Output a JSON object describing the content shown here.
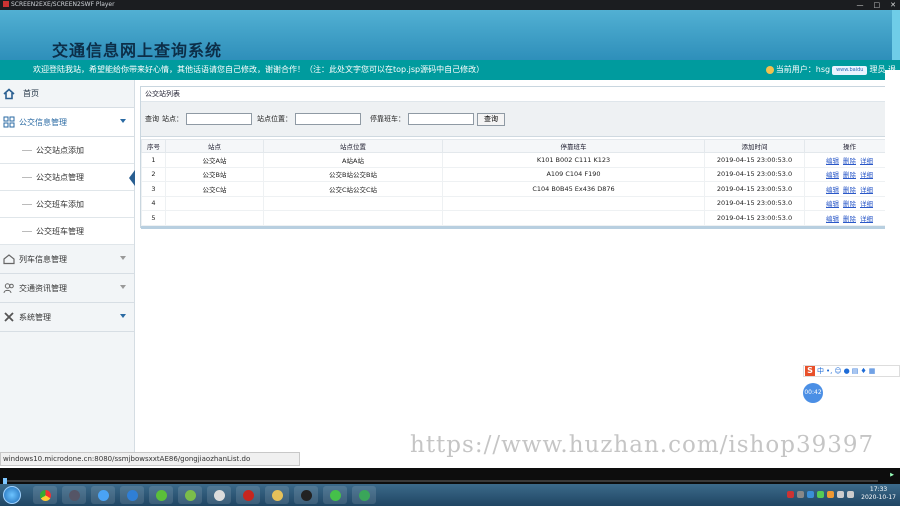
{
  "window": {
    "title": "SCREEN2EXE/SCREEN2SWF Player"
  },
  "header": {
    "system_title": "交通信息网上查询系统"
  },
  "notice": {
    "message": "欢迎登陆我站，希望能给你带来好心情，其他话语请您自己修改，谢谢合作！（注：此处文字您可以在top.jsp源码中自己修改）",
    "user_label": "当前用户：hsg",
    "cloud_badge": "www.baidu",
    "trailing": "理员 退"
  },
  "sidebar": {
    "home": "首页",
    "groups": [
      {
        "label": "公交信息管理",
        "expanded": true,
        "subitems": [
          "公交站点添加",
          "公交站点管理",
          "公交班车添加",
          "公交班车管理"
        ],
        "current": "公交站点管理"
      },
      {
        "label": "列车信息管理",
        "expanded": false
      },
      {
        "label": "交通资讯管理",
        "expanded": false
      },
      {
        "label": "系统管理",
        "expanded": false
      }
    ]
  },
  "panel": {
    "title": "公交站列表",
    "search": {
      "prefix": "查询",
      "station_label": "站点：",
      "location_label": "站点位置：",
      "bus_label": "停靠班车：",
      "station_value": "",
      "location_value": "",
      "bus_value": "",
      "button": "查询"
    },
    "table": {
      "headers": [
        "序号",
        "站点",
        "站点位置",
        "停靠班车",
        "添加时间",
        "操作"
      ],
      "rows": [
        {
          "no": "1",
          "station": "公交A站",
          "location": "A站A站",
          "buses": "K101 B002 C111 K123",
          "time": "2019-04-15 23:00:53.0"
        },
        {
          "no": "2",
          "station": "公交B站",
          "location": "公交B站公交B站",
          "buses": "A109 C104 F190",
          "time": "2019-04-15 23:00:53.0"
        },
        {
          "no": "3",
          "station": "公交C站",
          "location": "公交C站公交C站",
          "buses": "C104 B0B45 Ex436 D876",
          "time": "2019-04-15 23:00:53.0"
        },
        {
          "no": "4",
          "station": "",
          "location": "",
          "buses": "",
          "time": "2019-04-15 23:00:53.0"
        },
        {
          "no": "5",
          "station": "",
          "location": "",
          "buses": "",
          "time": "2019-04-15 23:00:53.0"
        }
      ],
      "actions": [
        "编辑",
        "删除",
        "详细"
      ]
    }
  },
  "status_url": "windows10.microdone.cn:8080/ssmjbowsxxtAE86/gongjiaozhanList.do",
  "watermark": "https://www.huzhan.com/ishop39397",
  "ime": {
    "lang": "中",
    "timer": "00:42"
  },
  "taskbar": {
    "time": "17:33",
    "date": "2020-10-17"
  },
  "colors": {
    "header": "#3a9cc4",
    "notice": "#009b9e",
    "accent": "#2a6aa3",
    "link": "#2a58c8"
  }
}
